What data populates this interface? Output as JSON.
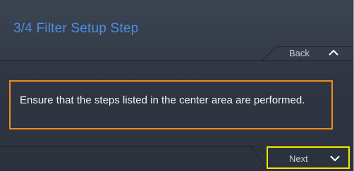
{
  "header": {
    "title": "3/4  Filter Setup Step"
  },
  "nav": {
    "back_label": "Back",
    "back_icon": "chevron-up-icon",
    "next_label": "Next",
    "next_icon": "chevron-down-icon"
  },
  "message": {
    "text": "Ensure that the steps listed in the center area are performed."
  },
  "colors": {
    "title": "#4a8fe3",
    "message_border": "#f08a22",
    "next_highlight": "#f2e600",
    "panel_bg": "#2f3642"
  }
}
